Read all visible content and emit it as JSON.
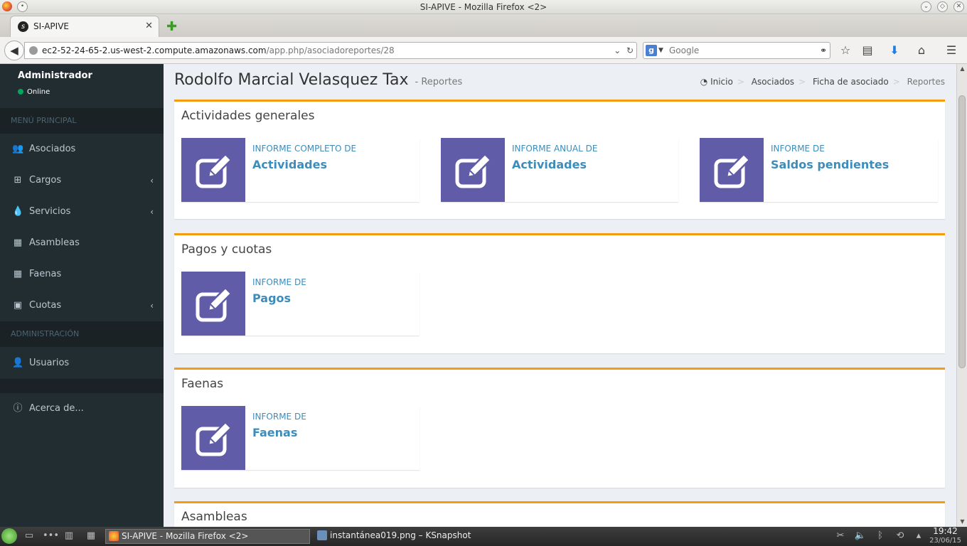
{
  "window": {
    "title": "SI-APIVE - Mozilla Firefox <2>",
    "tab_label": "SI-APIVE",
    "tab_close": "✕",
    "new_tab": "✚"
  },
  "navbar": {
    "url_host": "ec2-52-24-65-2.us-west-2.compute.amazonaws.com",
    "url_path": "/app.php/asociadoreportes/28",
    "search_placeholder": "Google",
    "search_engine": "g"
  },
  "sidebar": {
    "user_name": "Administrador",
    "user_status": "Online",
    "header_main": "MENÚ PRINCIPAL",
    "header_admin": "ADMINISTRACIÓN",
    "items": [
      {
        "label": "Asociados",
        "icon": "users-icon"
      },
      {
        "label": "Cargos",
        "icon": "sitemap-icon"
      },
      {
        "label": "Servicios",
        "icon": "tint-icon"
      },
      {
        "label": "Asambleas",
        "icon": "calendar-icon"
      },
      {
        "label": "Faenas",
        "icon": "calendar-icon"
      },
      {
        "label": "Cuotas",
        "icon": "money-icon"
      },
      {
        "label": "Usuarios",
        "icon": "user-icon"
      },
      {
        "label": "Acerca de...",
        "icon": "info-icon"
      }
    ]
  },
  "header": {
    "title": "Rodolfo Marcial Velasquez Tax",
    "subtitle": "- Reportes",
    "breadcrumb": [
      "Inicio",
      "Asociados",
      "Ficha de asociado",
      "Reportes"
    ]
  },
  "sections": [
    {
      "title": "Actividades generales",
      "cards": [
        {
          "text": "INFORME COMPLETO DE",
          "number": "Actividades"
        },
        {
          "text": "INFORME ANUAL DE",
          "number": "Actividades"
        },
        {
          "text": "INFORME DE",
          "number": "Saldos pendientes"
        }
      ]
    },
    {
      "title": "Pagos y cuotas",
      "cards": [
        {
          "text": "INFORME DE",
          "number": "Pagos"
        }
      ]
    },
    {
      "title": "Faenas",
      "cards": [
        {
          "text": "INFORME DE",
          "number": "Faenas"
        }
      ]
    },
    {
      "title": "Asambleas",
      "cards": []
    }
  ],
  "taskbar": {
    "tasks": [
      "SI-APIVE - Mozilla Firefox <2>",
      "instantánea019.png – KSnapshot"
    ],
    "time": "19:42",
    "date": "23/06/15"
  },
  "colors": {
    "accent": "#f39c12",
    "card_icon_bg": "#605ca8",
    "link": "#3c8dbc",
    "sidebar_bg": "#222d32"
  }
}
